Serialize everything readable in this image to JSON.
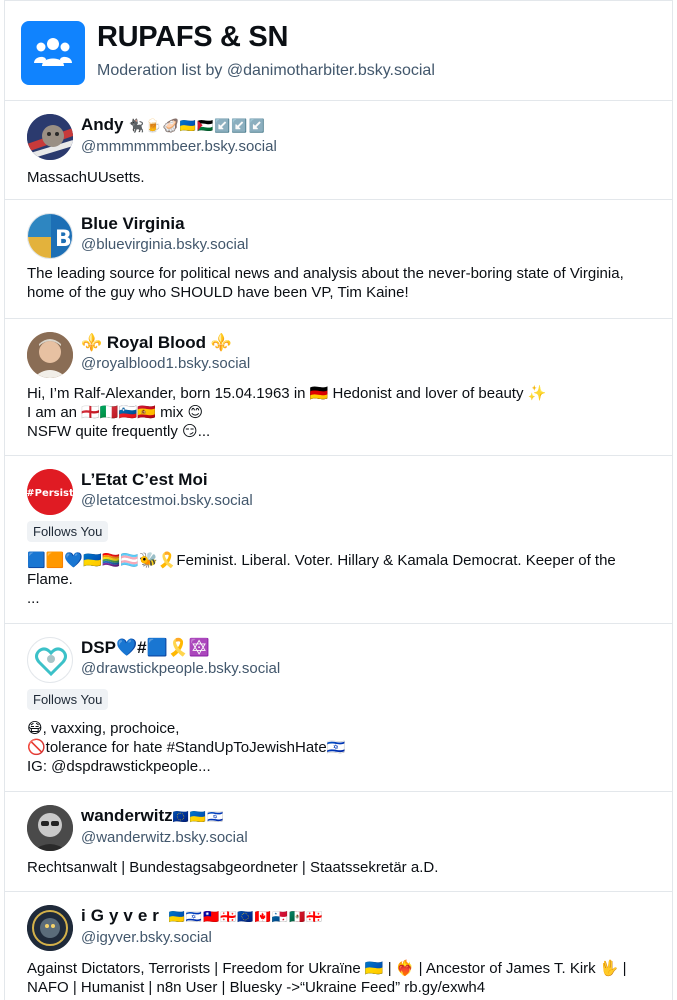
{
  "list": {
    "title": "RUPAFS & SN",
    "subtitle": "Moderation list by @danimotharbiter.bsky.social",
    "accent": "#1083fe"
  },
  "members": [
    {
      "name": "Andy",
      "name_suffix": "🐈‍⬛🍺🦪🇺🇦🇵🇸↙️↙️↙️",
      "handle": "@mmmmmmbeer.bsky.social",
      "badge": "",
      "bio": "MassachUUsetts."
    },
    {
      "name": "Blue Virginia",
      "name_suffix": "",
      "handle": "@bluevirginia.bsky.social",
      "badge": "",
      "bio": "The leading source for political news and analysis about the never-boring state of Virginia, home of the guy who SHOULD have been VP, Tim Kaine!"
    },
    {
      "name": "⚜️ Royal Blood ⚜️",
      "name_suffix": "",
      "handle": "@royalblood1.bsky.social",
      "badge": "",
      "bio": "Hi, I’m Ralf-Alexander, born 15.04.1963 in 🇩🇪        Hedonist and lover of beauty ✨\nI am an 🏴󠁧󠁢󠁥󠁮󠁧󠁿🇮🇹🇸🇮🇪🇸 mix 😊\nNSFW quite frequently 😏..."
    },
    {
      "name": "L’Etat C’est Moi",
      "name_suffix": "",
      "handle": "@letatcestmoi.bsky.social",
      "badge": "Follows You",
      "bio": "🟦🟧💙🇺🇦🏳️‍🌈🏳️‍⚧️🐝🎗️Feminist. Liberal. Voter. Hillary & Kamala Democrat. Keeper of the Flame.\n..."
    },
    {
      "name": "DSP💙#🟦🎗️🔯",
      "name_suffix": "",
      "handle": "@drawstickpeople.bsky.social",
      "badge": "Follows You",
      "bio": "😷, vaxxing, prochoice,\n🚫tolerance for hate #StandUpToJewishHate🇮🇱\nIG: @dspdrawstickpeople..."
    },
    {
      "name": "wanderwitz",
      "name_suffix": "🇪🇺🇺🇦🇮🇱",
      "handle": "@wanderwitz.bsky.social",
      "badge": "",
      "bio": "Rechtsanwalt | Bundestagsabgeordneter | Staatssekretär a.D."
    },
    {
      "name": "iGyver",
      "name_suffix": "🇺🇦🇮🇱🇹🇼🇬🇪🇪🇺🇨🇦🇵🇦🇲🇽🇬🇪",
      "handle": "@igyver.bsky.social",
      "badge": "",
      "bio": "Against Dictators, Terrorists | Freedom for Ukraïne 🇺🇦 | ❤️‍🔥 | Ancestor of James T. Kirk 🖖 | NAFO | Humanist | n8n User | Bluesky ->“Ukraine Feed” rb.gy/exwh4"
    }
  ]
}
